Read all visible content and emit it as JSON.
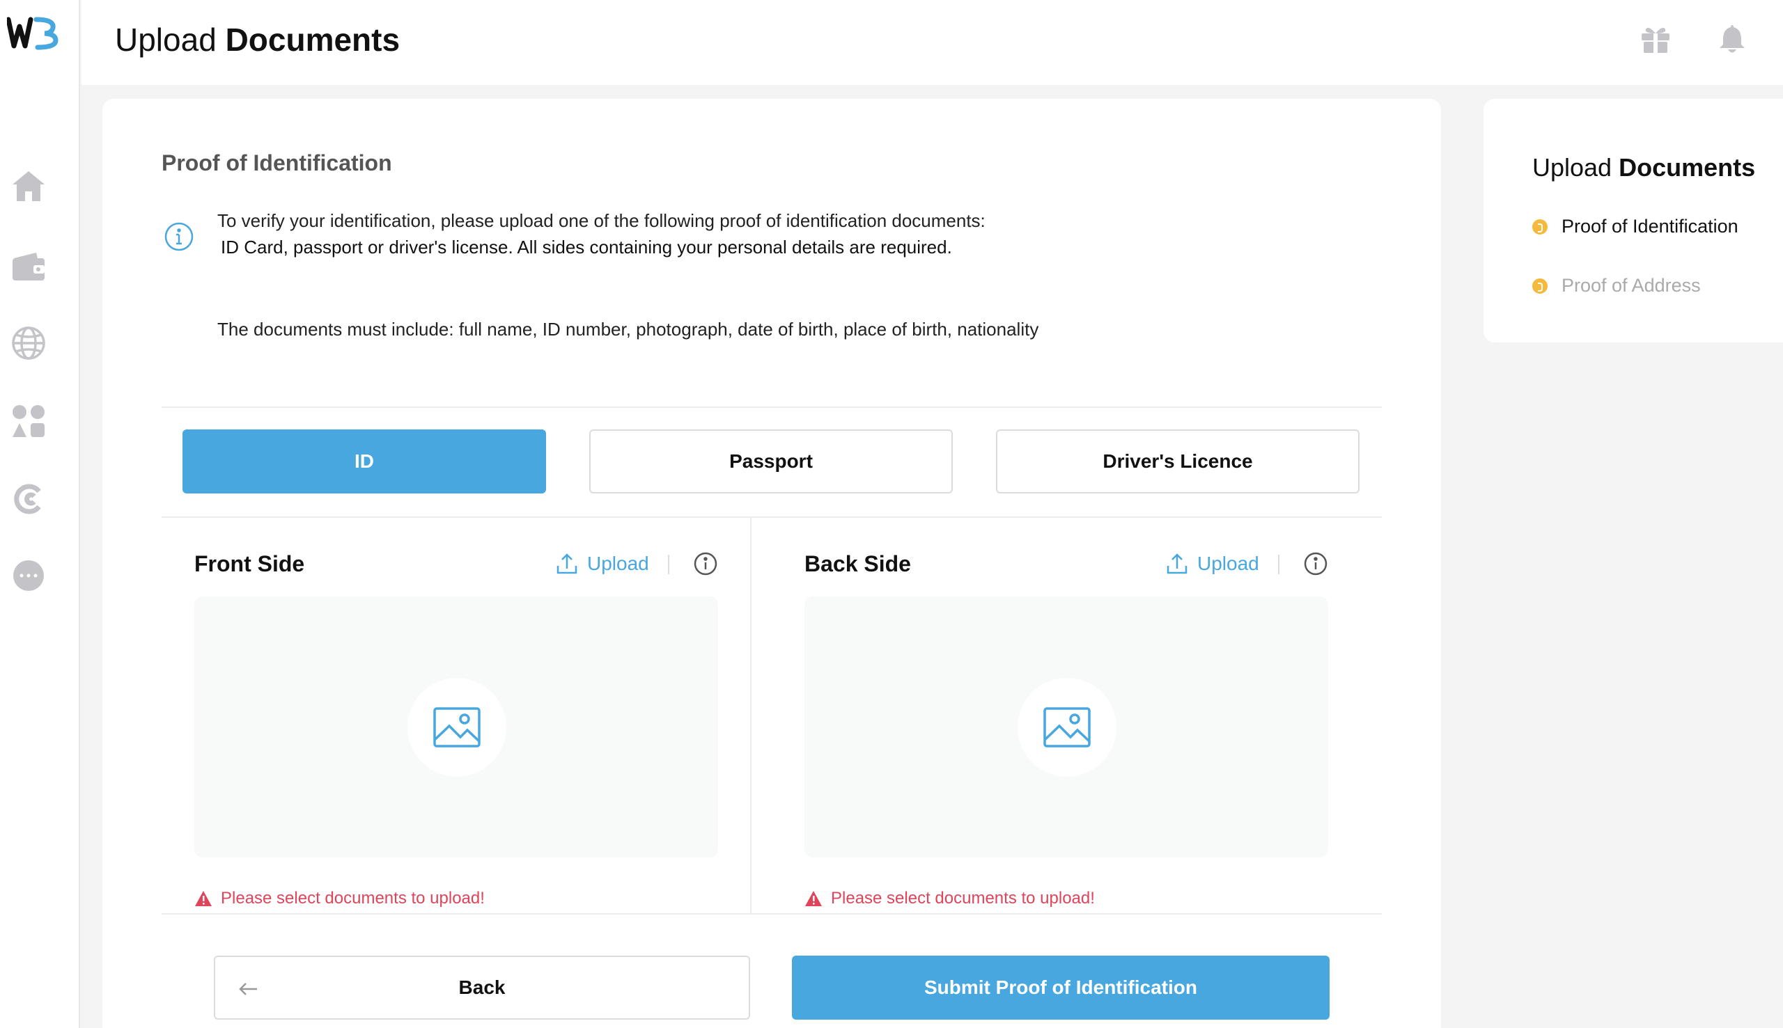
{
  "app": {
    "logo_text": "WB"
  },
  "header": {
    "title_light": "Upload",
    "title_bold": "Documents"
  },
  "section": {
    "title": "Proof of Identification",
    "info_line1": "To verify your identification, please upload one of the following proof of identification documents:",
    "info_line2": "ID Card, passport or driver's license. All sides containing your personal details are required.",
    "info_line3": "The documents must include: full name, ID number, photograph, date of birth, place of birth, nationality"
  },
  "doc_tabs": [
    {
      "label": "ID",
      "active": true
    },
    {
      "label": "Passport",
      "active": false
    },
    {
      "label": "Driver's Licence",
      "active": false
    }
  ],
  "panels": {
    "front": {
      "title": "Front Side",
      "upload_label": "Upload",
      "error": "Please select documents to upload!"
    },
    "back": {
      "title": "Back Side",
      "upload_label": "Upload",
      "error": "Please select documents to upload!"
    }
  },
  "actions": {
    "back_label": "Back",
    "submit_label": "Submit Proof of Identification"
  },
  "side_card": {
    "title_light": "Upload",
    "title_bold": "Documents",
    "steps": [
      {
        "label": "Proof of Identification",
        "state": "current"
      },
      {
        "label": "Proof of Address",
        "state": "pending"
      }
    ]
  },
  "colors": {
    "accent": "#47a7de",
    "error": "#e0445a",
    "step_dot": "#f5b93e",
    "icon_gray": "#c4c4c8"
  }
}
